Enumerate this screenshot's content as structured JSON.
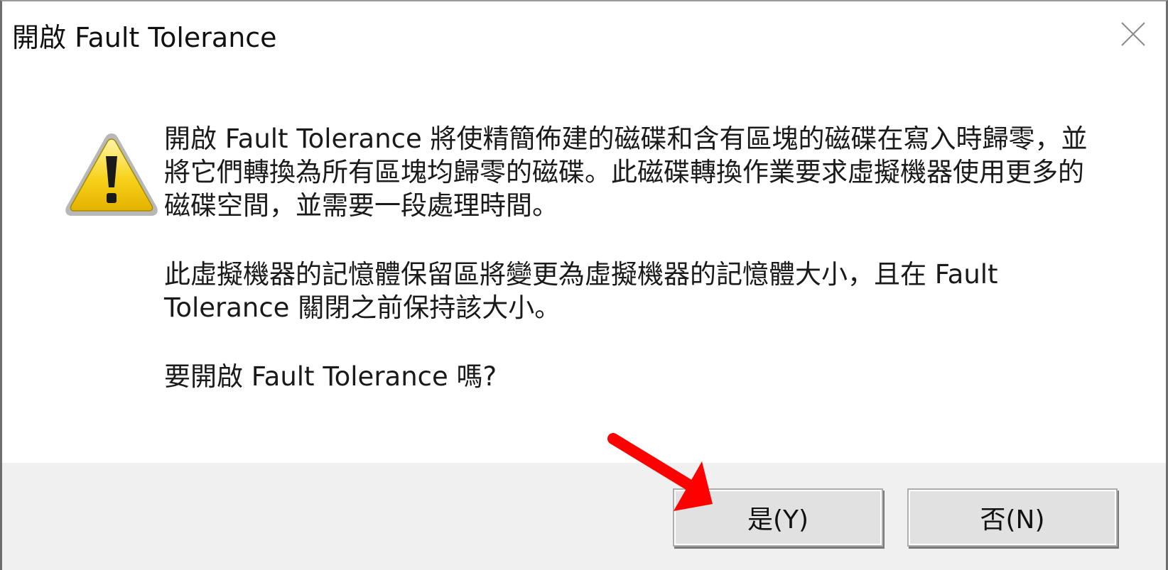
{
  "window": {
    "title": "開啟 Fault Tolerance",
    "close_icon": "close-icon"
  },
  "icon": {
    "name": "warning-icon",
    "color": "#f5c400"
  },
  "message": {
    "paragraph1": "開啟 Fault Tolerance 將使精簡佈建的磁碟和含有區塊的磁碟在寫入時歸零，並將它們轉換為所有區塊均歸零的磁碟。此磁碟轉換作業要求虛擬機器使用更多的磁碟空間，並需要一段處理時間。",
    "paragraph2": "此虛擬機器的記憶體保留區將變更為虛擬機器的記憶體大小，且在 Fault Tolerance 關閉之前保持該大小。",
    "paragraph3": "要開啟 Fault Tolerance 嗎?"
  },
  "buttons": {
    "yes_label": "是(Y)",
    "no_label": "否(N)"
  },
  "annotation": {
    "arrow_icon": "red-arrow-icon",
    "color": "#ff0000"
  }
}
